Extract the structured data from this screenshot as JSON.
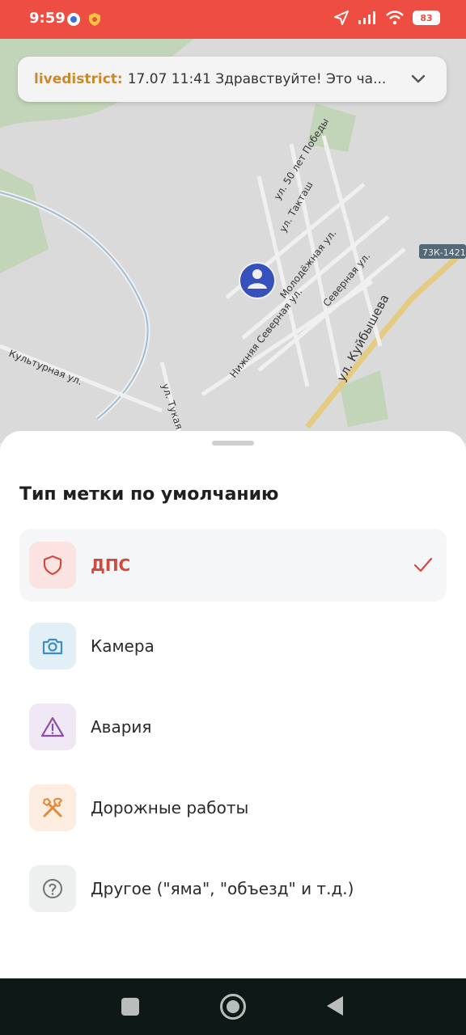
{
  "status_bar": {
    "time": "9:59",
    "battery": "83",
    "background_color": "#ee4e42",
    "icons": [
      "messenger-icon",
      "shield-badge-icon",
      "location-arrow-icon",
      "signal-icon",
      "wifi-icon",
      "battery-icon"
    ]
  },
  "map": {
    "streets": [
      "ул. 50 лет Победы",
      "ул. Такташ",
      "Молодёжная ул.",
      "Северная ул.",
      "Нижняя Северная ул.",
      "ул. Куйбышева",
      "Культурная ул.",
      "ул. Тукая"
    ],
    "road_badge": "73К-1421"
  },
  "chat": {
    "user": "livedistrict:",
    "message": "17.07 11:41 Здравствуйте! Это ча..."
  },
  "sheet": {
    "title": "Тип метки по умолчанию",
    "options": [
      {
        "label": "ДПС",
        "icon": "shield-icon",
        "selected": true,
        "icon_bg": "#fbe3e1",
        "icon_color": "#d14a3f"
      },
      {
        "label": "Камера",
        "icon": "camera-icon",
        "selected": false,
        "icon_bg": "#e2eff7",
        "icon_color": "#3a8fc6"
      },
      {
        "label": "Авария",
        "icon": "warning-triangle-icon",
        "selected": false,
        "icon_bg": "#f0e7f5",
        "icon_color": "#8a4da8"
      },
      {
        "label": "Дорожные работы",
        "icon": "tools-icon",
        "selected": false,
        "icon_bg": "#fdece0",
        "icon_color": "#e08a3a"
      },
      {
        "label": "Другое (\"яма\", \"объезд\" и т.д.)",
        "icon": "question-icon",
        "selected": false,
        "icon_bg": "#eef0f0",
        "icon_color": "#6c7372"
      }
    ]
  },
  "accent_color": "#d14a3f"
}
